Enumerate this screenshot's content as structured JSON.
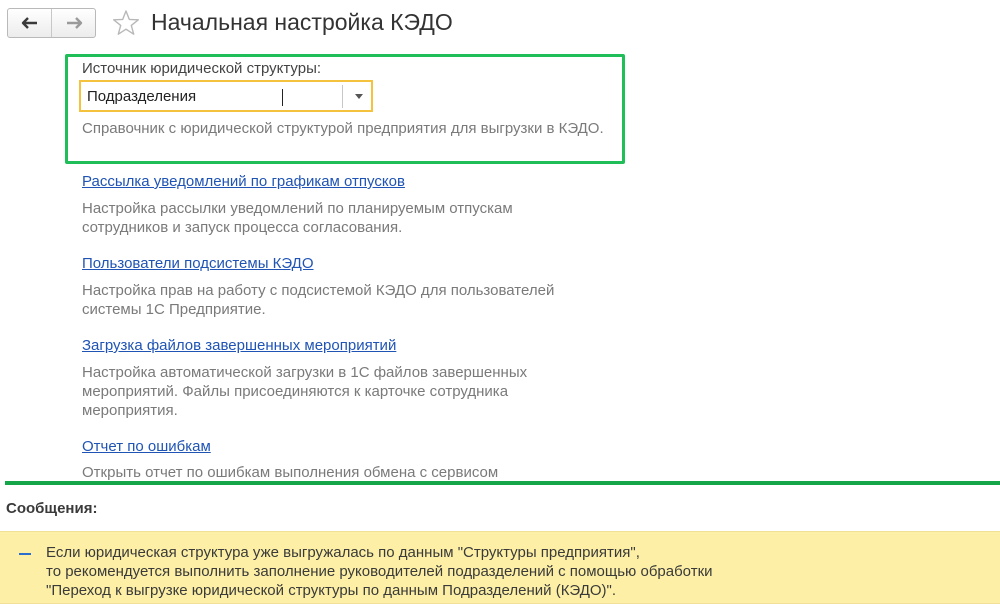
{
  "header": {
    "title": "Начальная настройка КЭДО",
    "back_icon": "arrow-left-icon",
    "forward_icon": "arrow-right-icon",
    "favorite_icon": "star-icon"
  },
  "legal_structure": {
    "label": "Источник юридической структуры:",
    "value": "Подразделения",
    "help": "Справочник с юридической структурой предприятия для выгрузки в КЭДО."
  },
  "sections": [
    {
      "link": "Рассылка уведомлений по графикам отпусков",
      "help": [
        "Настройка рассылки уведомлений по планируемым отпускам",
        "сотрудников и запуск процесса согласования."
      ]
    },
    {
      "link": "Пользователи подсистемы КЭДО",
      "help": [
        "Настройка прав на работу с подсистемой КЭДО для пользователей",
        "системы 1С Предприятие."
      ]
    },
    {
      "link": "Загрузка файлов завершенных мероприятий",
      "help": [
        "Настройка автоматической загрузки в 1С файлов завершенных",
        "мероприятий. Файлы присоединяются к карточке сотрудника",
        "мероприятия."
      ]
    },
    {
      "link": "Отчет по ошибкам",
      "help": [
        "Открыть отчет по ошибкам выполнения обмена с сервисом"
      ]
    }
  ],
  "messages": {
    "title": "Сообщения:",
    "items": [
      {
        "lines": [
          "Если юридическая структура уже выгружалась по данным \"Структуры предприятия\",",
          "то рекомендуется выполнить заполнение руководителей подразделений с помощью обработки",
          "\"Переход к выгрузке юридической структуры по данным Подразделений (КЭДО)\"."
        ]
      }
    ]
  },
  "colors": {
    "highlight_border": "#1fbe58",
    "field_focus": "#f5c23d",
    "link": "#1f54b5",
    "message_background": "#fdf0a6",
    "separator": "#16a64a"
  }
}
